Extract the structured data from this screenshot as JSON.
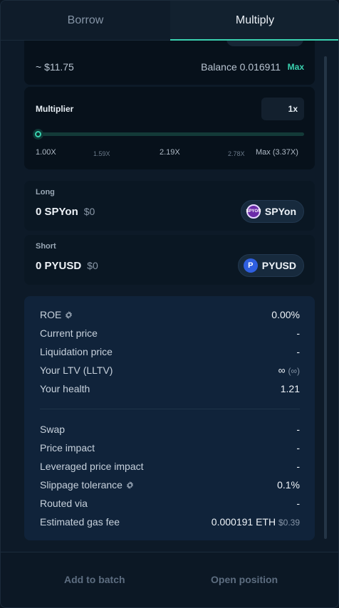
{
  "tabs": [
    {
      "label": "Borrow",
      "active": false
    },
    {
      "label": "Multiply",
      "active": true
    }
  ],
  "amount": {
    "usd_value": "~ $11.75",
    "balance": "Balance 0.016911",
    "max_label": "Max"
  },
  "multiplier": {
    "label": "Multiplier",
    "value": "1x",
    "slider_fraction": 0,
    "ticks": [
      "1.00X",
      "1.59X",
      "2.19X",
      "2.78X",
      "Max (3.37X)"
    ]
  },
  "long": {
    "label": "Long",
    "amount": "0 SPYon",
    "usd": "$0",
    "token": "SPYon",
    "icon": "spyon-token-icon",
    "icon_text": "SPYON"
  },
  "short": {
    "label": "Short",
    "amount": "0 PYUSD",
    "usd": "$0",
    "token": "PYUSD",
    "icon": "pyusd-token-icon",
    "icon_text": "P"
  },
  "stats": {
    "roe": {
      "label": "ROE",
      "value": "0.00%"
    },
    "current_price": {
      "label": "Current price",
      "value": "-"
    },
    "liquidation_price": {
      "label": "Liquidation price",
      "value": "-"
    },
    "ltv": {
      "label": "Your LTV (LLTV)",
      "value": "∞",
      "sub": "(∞)"
    },
    "health": {
      "label": "Your health",
      "value": "1.21"
    },
    "swap": {
      "label": "Swap",
      "value": "-"
    },
    "price_impact": {
      "label": "Price impact",
      "value": "-"
    },
    "leveraged_price_impact": {
      "label": "Leveraged price impact",
      "value": "-"
    },
    "slippage": {
      "label": "Slippage tolerance",
      "value": "0.1%"
    },
    "routed_via": {
      "label": "Routed via",
      "value": "-"
    },
    "gas_fee": {
      "label": "Estimated gas fee",
      "value": "0.000191 ETH",
      "sub": "$0.39"
    }
  },
  "footer": {
    "add_to_batch": "Add to batch",
    "open_position": "Open position"
  },
  "colors": {
    "accent": "#3ad2b0",
    "background": "#0d1a28",
    "card": "#07111b",
    "stats_card": "#10233a"
  }
}
